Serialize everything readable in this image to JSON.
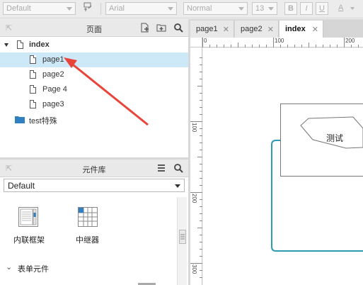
{
  "toolbar": {
    "style_select": "Default",
    "font_select": "Arial",
    "weight_select": "Normal",
    "size_select": "13",
    "bold": "B",
    "italic": "I",
    "underline": "U",
    "font_color": "A"
  },
  "pages_panel": {
    "title": "页面",
    "tree": [
      {
        "label": "index",
        "type": "page",
        "level": 0,
        "expanded": true
      },
      {
        "label": "page1",
        "type": "page",
        "level": 1,
        "selected": true
      },
      {
        "label": "page2",
        "type": "page",
        "level": 1
      },
      {
        "label": "Page 4",
        "type": "page",
        "level": 1
      },
      {
        "label": "page3",
        "type": "page",
        "level": 1
      },
      {
        "label": "test特殊",
        "type": "folder",
        "level": 0
      }
    ]
  },
  "library_panel": {
    "title": "元件库",
    "selected_library": "Default",
    "items": [
      {
        "label": "内联框架",
        "icon": "inline-frame-icon"
      },
      {
        "label": "中继器",
        "icon": "repeater-icon"
      }
    ],
    "section": "表单元件"
  },
  "editor": {
    "tabs": [
      {
        "label": "page1",
        "active": false
      },
      {
        "label": "page2",
        "active": false
      },
      {
        "label": "index",
        "active": true
      }
    ],
    "ruler_top": [
      "0",
      "100",
      "200"
    ],
    "ruler_left": [
      "100",
      "200",
      "300"
    ],
    "shape_text": "测试"
  },
  "colors": {
    "selection": "#cde8f6",
    "accent_arrow": "#e8443a",
    "repeater_border": "#2e9bb0",
    "folder": "#2f7fc1"
  }
}
